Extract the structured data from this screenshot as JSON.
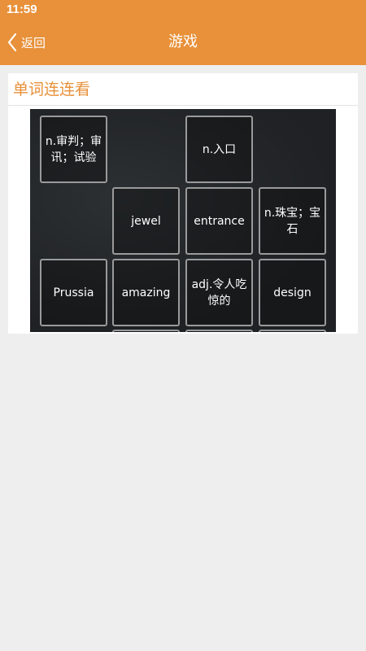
{
  "status_bar": {
    "time": "11:59"
  },
  "app_bar": {
    "back_label": "返回",
    "title": "游戏"
  },
  "card": {
    "title": "单词连连看"
  },
  "game": {
    "tiles": [
      {
        "text": "n.审判；审讯；试验"
      },
      {
        "text": "n.入口"
      },
      {
        "text": "jewel"
      },
      {
        "text": "entrance"
      },
      {
        "text": "n.珠宝；宝石"
      },
      {
        "text": "Prussia"
      },
      {
        "text": "amazing"
      },
      {
        "text": "adj.令人吃惊的"
      },
      {
        "text": "design"
      },
      {
        "text": ""
      },
      {
        "text": ""
      },
      {
        "text": ""
      }
    ]
  },
  "colors": {
    "accent": "#e8913a",
    "board": "#222528",
    "tile_border": "#9a9a9a"
  }
}
